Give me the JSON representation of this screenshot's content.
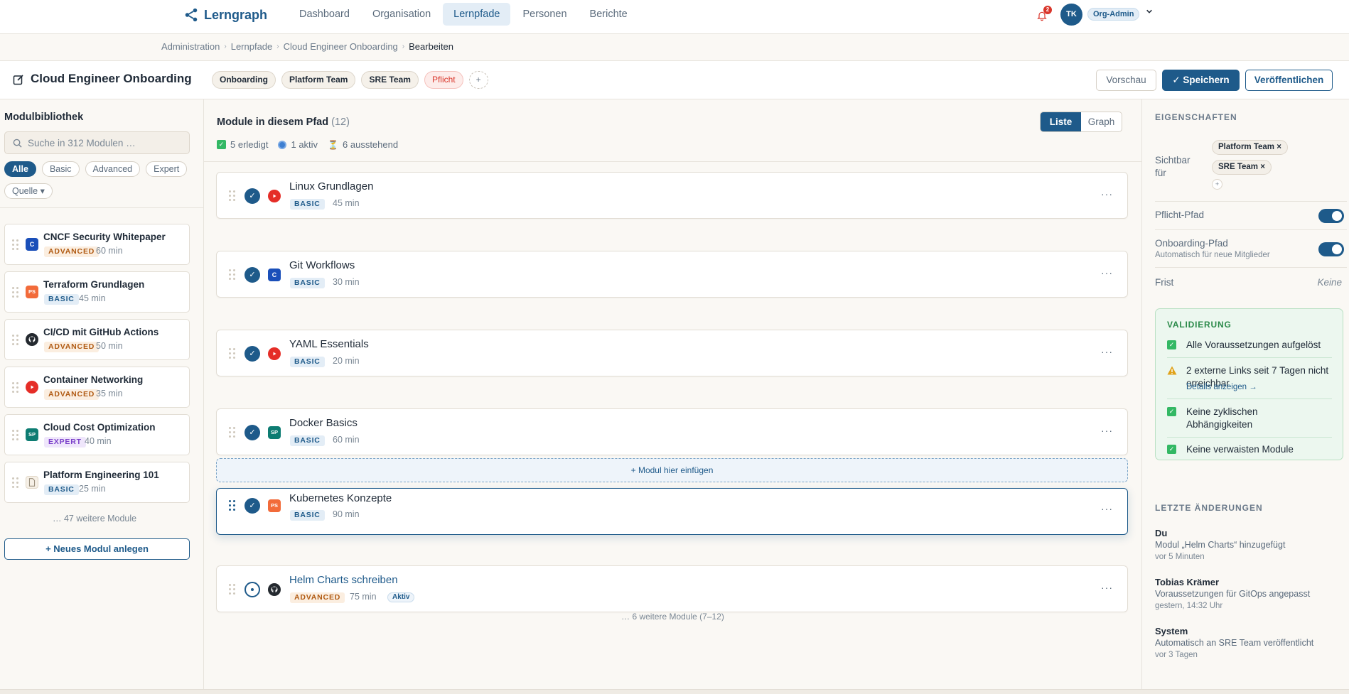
{
  "app": {
    "name": "Lerngraph"
  },
  "nav": {
    "items": [
      {
        "label": "Dashboard"
      },
      {
        "label": "Organisation"
      },
      {
        "label": "Lernpfade"
      },
      {
        "label": "Personen"
      },
      {
        "label": "Berichte"
      }
    ],
    "active": "Lernpfade",
    "notifications_count": "2",
    "user_initials": "TK",
    "user_role": "Org-Admin"
  },
  "breadcrumb": [
    "Administration",
    "Lernpfade",
    "Cloud Engineer Onboarding",
    "Bearbeiten"
  ],
  "page": {
    "title": "Cloud Engineer Onboarding",
    "tags": [
      "Onboarding",
      "Platform Team",
      "SRE Team",
      "Pflicht"
    ],
    "add_tag": "+",
    "buttons": {
      "preview": "Vorschau",
      "save": "✓ Speichern",
      "publish": "Veröffentlichen"
    }
  },
  "library": {
    "title": "Modulbibliothek",
    "search_placeholder": "Suche in 312 Modulen …",
    "filters": [
      "Alle",
      "Basic",
      "Advanced",
      "Expert"
    ],
    "source_filter": "Quelle ▾",
    "modules": [
      {
        "title": "CNCF Security Whitepaper",
        "level": "ADVANCED",
        "duration": "60 min",
        "source": "C"
      },
      {
        "title": "Terraform Grundlagen",
        "level": "BASIC",
        "duration": "45 min",
        "source": "PS"
      },
      {
        "title": "CI/CD mit GitHub Actions",
        "level": "ADVANCED",
        "duration": "50 min",
        "source": "github-icon"
      },
      {
        "title": "Container Networking",
        "level": "ADVANCED",
        "duration": "35 min",
        "source": "youtube-icon"
      },
      {
        "title": "Cloud Cost Optimization",
        "level": "EXPERT",
        "duration": "40 min",
        "source": "SP"
      },
      {
        "title": "Platform Engineering 101",
        "level": "BASIC",
        "duration": "25 min",
        "source": "document-icon"
      }
    ],
    "more": "… 47 weitere Module",
    "new_button": "+   Neues Modul anlegen"
  },
  "path": {
    "title": "Module in diesem Pfad",
    "count": "(12)",
    "stats": {
      "done": "5 erledigt",
      "active": "1 aktiv",
      "pending": "6 ausstehend"
    },
    "view_toggle": [
      "Liste",
      "Graph"
    ],
    "modules": [
      {
        "title": "Linux Grundlagen",
        "level": "BASIC",
        "duration": "45 min",
        "source": "youtube-icon",
        "status": "done"
      },
      {
        "title": "Git Workflows",
        "level": "BASIC",
        "duration": "30 min",
        "source": "C",
        "status": "done"
      },
      {
        "title": "YAML Essentials",
        "level": "BASIC",
        "duration": "20 min",
        "source": "youtube-icon",
        "status": "done"
      },
      {
        "title": "Docker Basics",
        "level": "BASIC",
        "duration": "60 min",
        "source": "SP",
        "status": "done"
      },
      {
        "title": "Kubernetes Konzepte",
        "level": "BASIC",
        "duration": "90 min",
        "source": "PS",
        "status": "done"
      },
      {
        "title": "Helm Charts schreiben",
        "level": "ADVANCED",
        "duration": "75 min",
        "source": "github-icon",
        "status": "active",
        "badge": "Aktiv"
      }
    ],
    "drop_zone": "+ Modul hier einfügen",
    "more": "… 6 weitere Module (7–12)",
    "more_menu": "···"
  },
  "properties": {
    "title": "EIGENSCHAFTEN",
    "visible_label": "Sichtbar für",
    "visible_for": [
      "Platform Team ×",
      "SRE Team ×"
    ],
    "visible_add": "+",
    "mandatory_label": "Pflicht-Pfad",
    "mandatory_on": true,
    "onboarding_label": "Onboarding-Pfad",
    "onboarding_sub": "Automatisch für neue Mitglieder",
    "onboarding_on": true,
    "deadline_label": "Frist",
    "deadline_value": "Keine"
  },
  "validation": {
    "title": "VALIDIERUNG",
    "items": [
      {
        "text": "Alle Voraussetzungen aufgelöst",
        "status": "ok"
      },
      {
        "text": "2 externe Links seit 7 Tagen nicht erreichbar",
        "status": "warning",
        "link": "Details anzeigen →"
      },
      {
        "text": "Keine zyklischen Abhängigkeiten",
        "status": "ok"
      },
      {
        "text": "Keine verwaisten Module",
        "status": "ok"
      }
    ]
  },
  "changes": {
    "title": "LETZTE ÄNDERUNGEN",
    "items": [
      {
        "author": "Du",
        "text": "Modul „Helm Charts“ hinzugefügt",
        "time": "vor 5 Minuten"
      },
      {
        "author": "Tobias Krämer",
        "text": "Voraussetzungen für GitOps angepasst",
        "time": "gestern, 14:32 Uhr"
      },
      {
        "author": "System",
        "text": "Automatisch an SRE Team veröffentlicht",
        "time": "vor 3 Tagen"
      }
    ]
  },
  "colors": {
    "primary": "#1e5a8a",
    "success": "#33b864",
    "danger": "#d9362b",
    "warning": "#e0a21a",
    "background": "#faf8f4"
  }
}
